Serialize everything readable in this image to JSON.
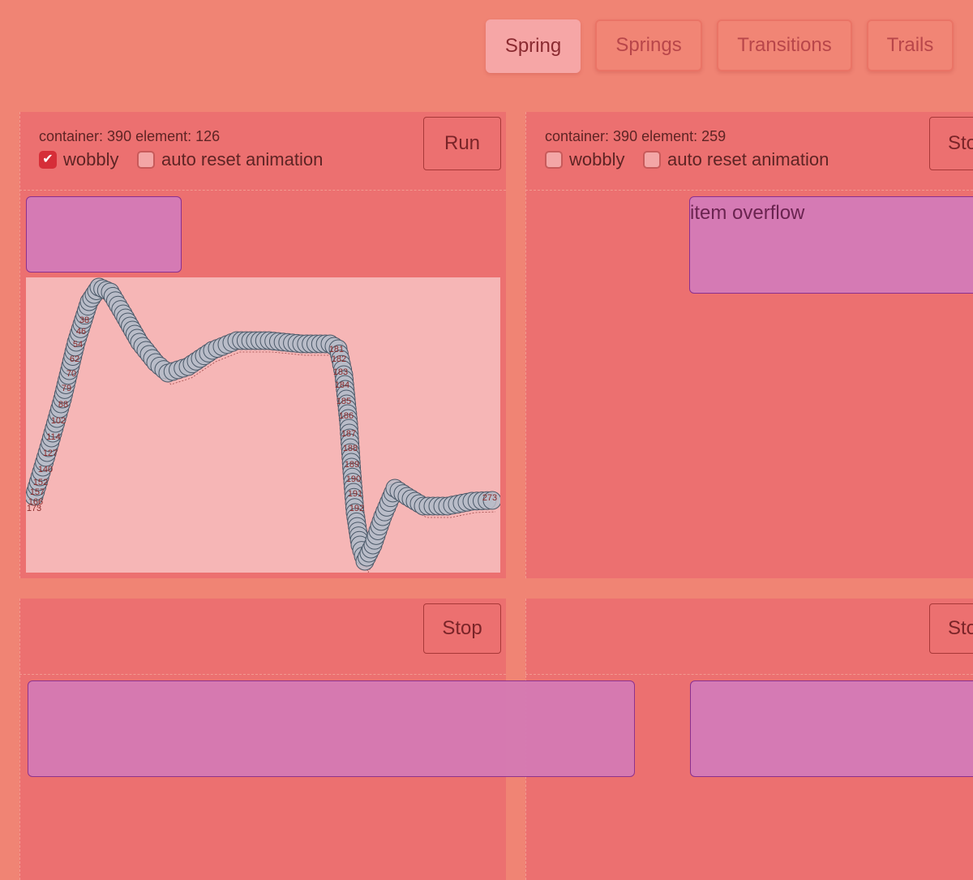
{
  "tabs": [
    {
      "label": "Spring",
      "active": true
    },
    {
      "label": "Springs",
      "active": false
    },
    {
      "label": "Transitions",
      "active": false
    },
    {
      "label": "Trails",
      "active": false
    }
  ],
  "panels": [
    {
      "info": "container: 390 element: 126",
      "wobbly_label": "wobbly",
      "wobbly_checked": true,
      "auto_reset_label": "auto reset animation",
      "auto_reset_checked": false,
      "button_label": "Run"
    },
    {
      "info": "container: 390 element: 259",
      "wobbly_label": "wobbly",
      "wobbly_checked": false,
      "auto_reset_label": "auto reset animation",
      "auto_reset_checked": false,
      "button_label": "Stop",
      "item_text": "item overflow"
    },
    {
      "button_label": "Stop"
    },
    {
      "button_label": "Stop"
    }
  ],
  "chart_data": {
    "type": "scatter",
    "title": "",
    "xlabel": "",
    "ylabel": "",
    "labeled_points": [
      "173",
      "166",
      "157",
      "152",
      "140",
      "127",
      "114",
      "102",
      "88",
      "79",
      "70",
      "62",
      "54",
      "46",
      "38",
      "181",
      "182",
      "183",
      "184",
      "185",
      "186",
      "187",
      "188",
      "189",
      "190",
      "191",
      "192",
      "273"
    ],
    "colors": {
      "trail": "#d42020",
      "marker_fill": "#b8bcc8",
      "marker_stroke": "#4a5868",
      "background": "#f6b6b6"
    }
  }
}
